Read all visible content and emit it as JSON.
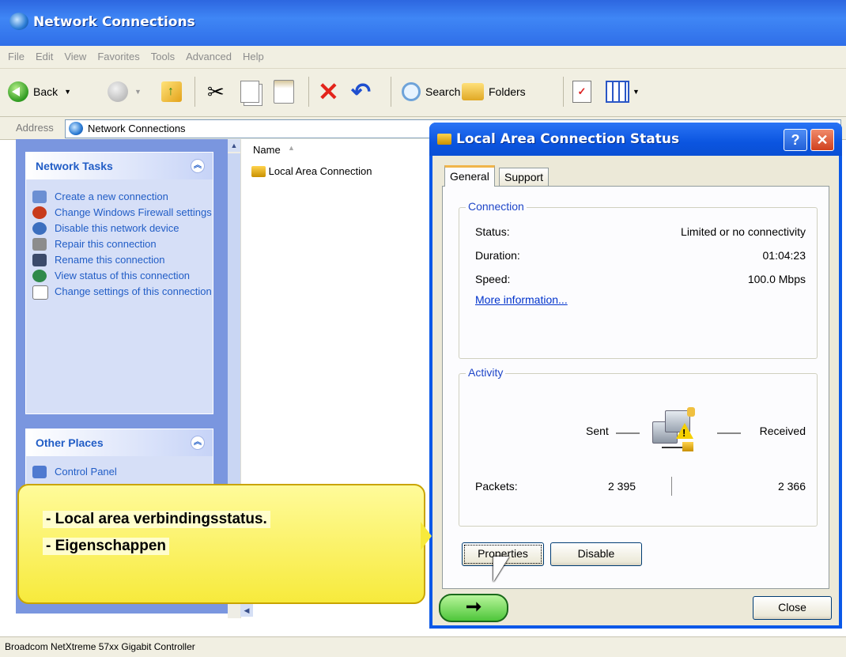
{
  "window": {
    "title": "Network Connections"
  },
  "menu": [
    "File",
    "Edit",
    "View",
    "Favorites",
    "Tools",
    "Advanced",
    "Help"
  ],
  "toolbar": {
    "back": "Back",
    "search": "Search",
    "folders": "Folders"
  },
  "address": {
    "label": "Address",
    "value": "Network Connections"
  },
  "network_tasks": {
    "title": "Network Tasks",
    "items": [
      {
        "label": "Create a new connection",
        "icon": "new-connection-icon"
      },
      {
        "label": "Change Windows Firewall settings",
        "icon": "firewall-icon"
      },
      {
        "label": "Disable this network device",
        "icon": "disable-device-icon"
      },
      {
        "label": "Repair this connection",
        "icon": "repair-icon"
      },
      {
        "label": "Rename this connection",
        "icon": "rename-icon"
      },
      {
        "label": "View status of this connection",
        "icon": "view-status-icon"
      },
      {
        "label": "Change settings of this connection",
        "icon": "change-settings-icon"
      }
    ]
  },
  "other_places": {
    "title": "Other Places",
    "items": [
      {
        "label": "Control Panel"
      }
    ]
  },
  "filelist": {
    "column_name": "Name",
    "items": [
      {
        "label": "Local Area Connection"
      }
    ]
  },
  "status_bar": {
    "text": "Broadcom NetXtreme 57xx Gigabit Controller"
  },
  "dialog": {
    "title": "Local Area Connection Status",
    "tabs": [
      "General",
      "Support"
    ],
    "connection": {
      "legend": "Connection",
      "status_label": "Status:",
      "status_value": "Limited or no connectivity",
      "duration_label": "Duration:",
      "duration_value": "01:04:23",
      "speed_label": "Speed:",
      "speed_value": "100.0 Mbps",
      "more_info": "More information..."
    },
    "activity": {
      "legend": "Activity",
      "sent": "Sent",
      "received": "Received",
      "packets_label": "Packets:",
      "packets_sent": "2 395",
      "packets_received": "2 366"
    },
    "buttons": {
      "properties": "Properties",
      "disable": "Disable",
      "close": "Close"
    }
  },
  "callout": {
    "line1": "- Local area verbindingsstatus.",
    "line2": "- Eigenschappen"
  }
}
